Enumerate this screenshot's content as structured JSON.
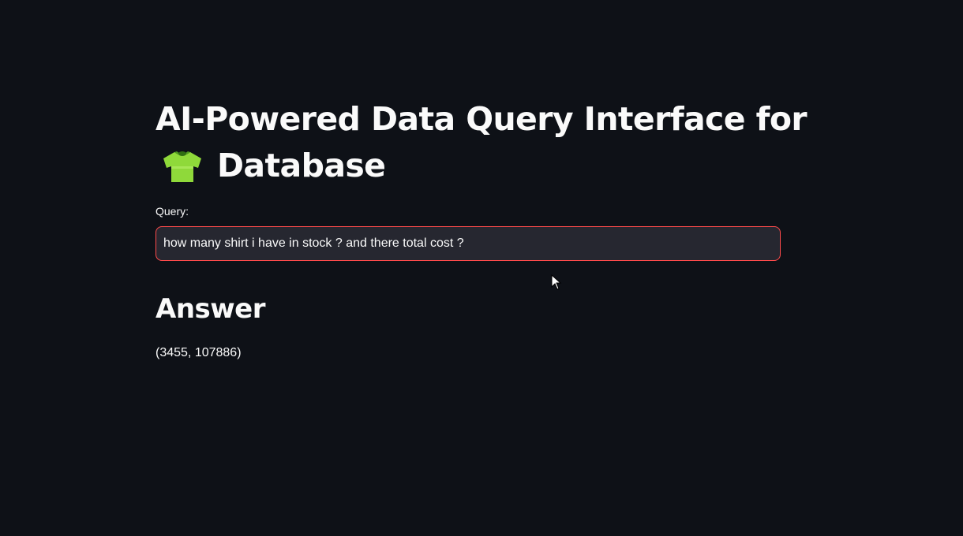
{
  "header": {
    "title_line1": "AI-Powered Data Query Interface for",
    "title_line2": "Database",
    "title_icon": "t-shirt-icon"
  },
  "query": {
    "label": "Query:",
    "value": "how many shirt i have in stock ? and there total cost ?"
  },
  "answer": {
    "heading": "Answer",
    "value": "(3455, 107886)"
  },
  "colors": {
    "background": "#0e1117",
    "input_background": "#262730",
    "input_border_focus": "#ff4b4b",
    "text": "#fafafa",
    "shirt": "#8fd93a"
  }
}
